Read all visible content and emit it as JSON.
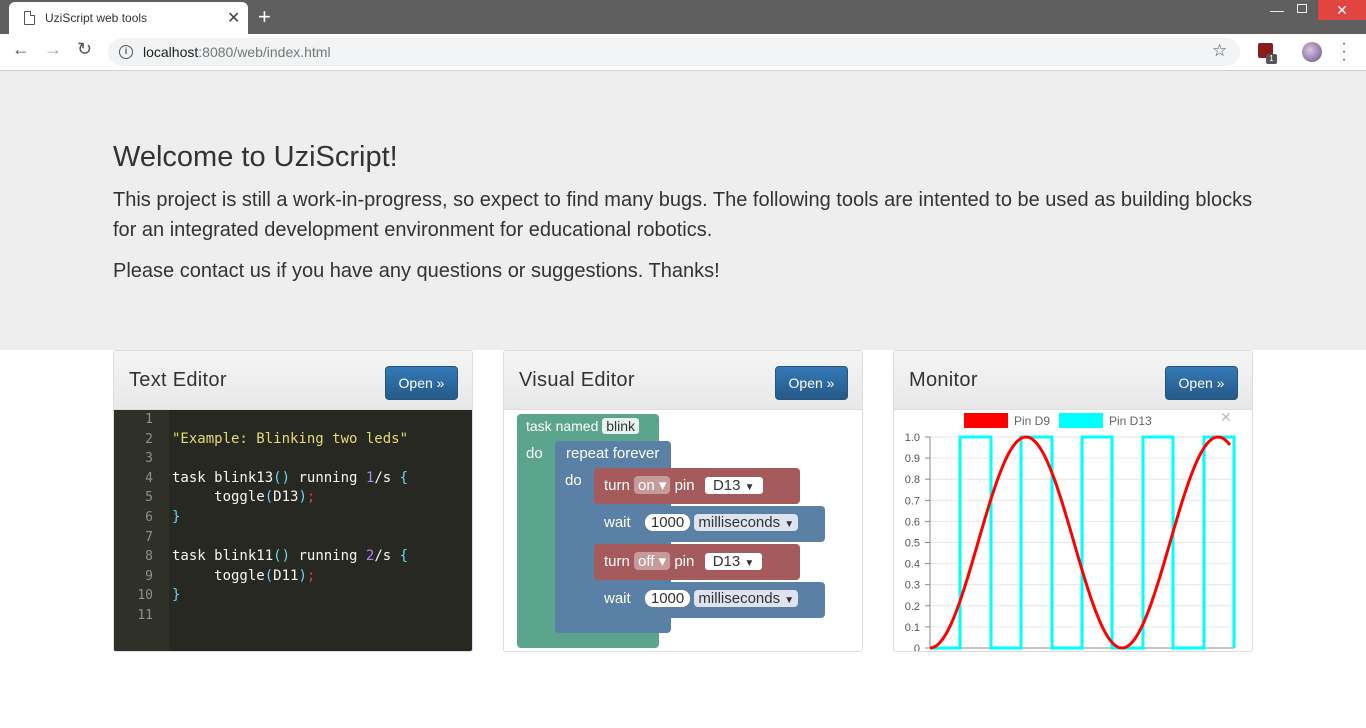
{
  "browser": {
    "tab_title": "UziScript web tools",
    "url_host": "localhost",
    "url_path": ":8080/web/index.html",
    "ext_badge": "1"
  },
  "jumbotron": {
    "title": "Welcome to UziScript!",
    "paragraph1": "This project is still a work-in-progress, so expect to find many bugs. The following tools are intented to be used as building blocks for an integrated development environment for educational robotics.",
    "paragraph2": "Please contact us if you have any questions or suggestions. Thanks!"
  },
  "panels": [
    {
      "title": "Text Editor",
      "button": "Open »"
    },
    {
      "title": "Visual Editor",
      "button": "Open »"
    },
    {
      "title": "Monitor",
      "button": "Open »"
    }
  ],
  "code_lines": [
    "",
    "\"Example: Blinking two leds\"",
    "",
    "task blink13() running 1/s {",
    "     toggle(D13);",
    "}",
    "",
    "task blink11() running 2/s {",
    "     toggle(D11);",
    "}",
    ""
  ],
  "line_numbers": [
    "1",
    "2",
    "3",
    "4",
    "5",
    "6",
    "7",
    "8",
    "9",
    "10",
    "11"
  ],
  "visual": {
    "task_label": "task named",
    "task_name": "blink",
    "do": "do",
    "repeat": "repeat forever",
    "turn": "turn",
    "on": "on",
    "off": "off",
    "pin": "pin",
    "pin_value": "D13",
    "wait": "wait",
    "ms_value": "1000",
    "ms_unit": "milliseconds"
  },
  "chart_data": {
    "type": "line",
    "series": [
      {
        "name": "Pin D9",
        "color": "#ff0000",
        "shape": "sine"
      },
      {
        "name": "Pin D13",
        "color": "#00ffff",
        "shape": "square"
      }
    ],
    "ylim": [
      0,
      1
    ],
    "yticks": [
      "0",
      "0.1",
      "0.2",
      "0.3",
      "0.4",
      "0.5",
      "0.6",
      "0.7",
      "0.8",
      "0.9",
      "1.0"
    ],
    "grid": true,
    "legend": "top-center"
  },
  "colors": {
    "primary": "#337ab7",
    "task_block": "#5ba58c",
    "loop_block": "#5b80a5",
    "turn_block": "#a55b5b"
  }
}
